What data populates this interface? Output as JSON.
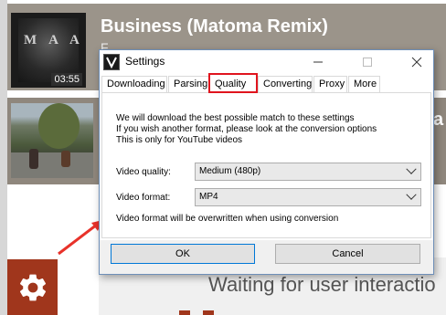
{
  "background_list": {
    "items": [
      {
        "title": "Business (Matoma Remix)",
        "subtitle": "F...",
        "duration": "03:55",
        "art_text": "M A A"
      },
      {
        "title_fragment": "a"
      }
    ]
  },
  "status": {
    "text": "Waiting for user interactio"
  },
  "dialog": {
    "title": "Settings",
    "tabs": [
      {
        "label": "Downloading"
      },
      {
        "label": "Parsing"
      },
      {
        "label": "Quality",
        "selected": true
      },
      {
        "label": "Converting"
      },
      {
        "label": "Proxy"
      },
      {
        "label": "More"
      }
    ],
    "info_lines": [
      "We will download the best possible match to these settings",
      "If you wish another format, please look at the conversion options",
      "This is only for YouTube videos"
    ],
    "video_quality": {
      "label": "Video quality:",
      "value": "Medium (480p)"
    },
    "video_format": {
      "label": "Video format:",
      "value": "MP4"
    },
    "note": "Video format will be overwritten when using conversion",
    "ok_label": "OK",
    "cancel_label": "Cancel"
  },
  "icons": {
    "settings": "gear-icon",
    "minimize": "minimize-icon",
    "maximize": "maximize-icon",
    "close": "close-icon",
    "dropdown": "chevron-down-icon",
    "app": "app-logo-icon"
  },
  "colors": {
    "accent_brown": "#a0361c",
    "highlight_red": "#e0141e",
    "card_bg": "#9b948a",
    "arrow_red": "#e8322a"
  }
}
